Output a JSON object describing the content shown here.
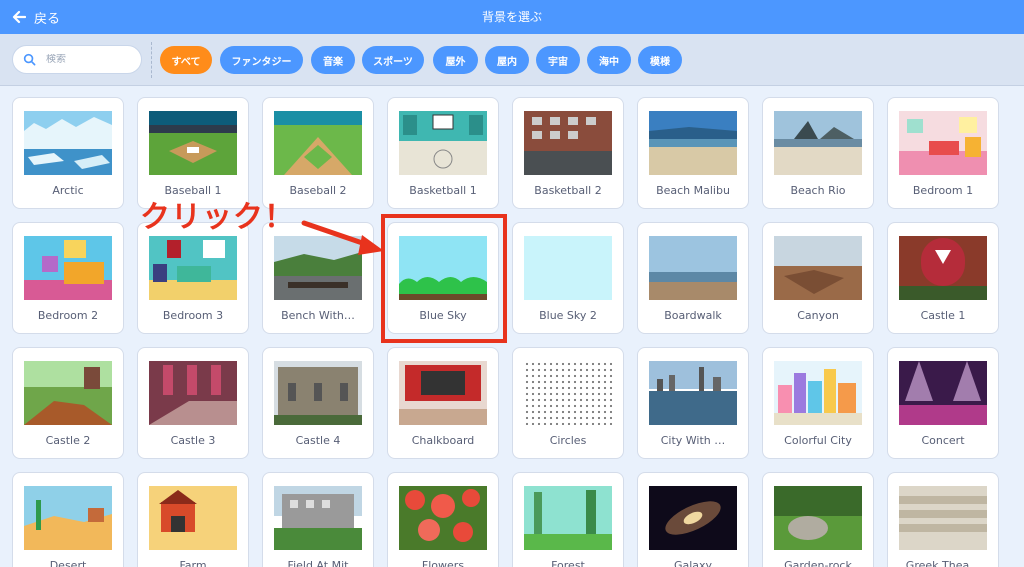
{
  "header": {
    "back_label": "戻る",
    "title": "背景を選ぶ"
  },
  "search": {
    "placeholder": "検索"
  },
  "tags": [
    {
      "label": "すべて",
      "active": true
    },
    {
      "label": "ファンタジー"
    },
    {
      "label": "音楽"
    },
    {
      "label": "スポーツ"
    },
    {
      "label": "屋外"
    },
    {
      "label": "屋内"
    },
    {
      "label": "宇宙"
    },
    {
      "label": "海中"
    },
    {
      "label": "模様"
    }
  ],
  "backdrops": [
    "Arctic",
    "Baseball 1",
    "Baseball 2",
    "Basketball 1",
    "Basketball 2",
    "Beach Malibu",
    "Beach Rio",
    "Bedroom 1",
    "Bedroom 2",
    "Bedroom 3",
    "Bench With…",
    "Blue Sky",
    "Blue Sky 2",
    "Boardwalk",
    "Canyon",
    "Castle 1",
    "Castle 2",
    "Castle 3",
    "Castle 4",
    "Chalkboard",
    "Circles",
    "City With …",
    "Colorful City",
    "Concert",
    "Desert",
    "Farm",
    "Field At Mit",
    "Flowers",
    "Forest",
    "Galaxy",
    "Garden-rock",
    "Greek Thea…"
  ],
  "annotation": {
    "text": "クリック！"
  },
  "colors": {
    "topbar": "#4c97ff",
    "active_tag": "#ff8c1a",
    "highlight": "#e8331d"
  }
}
